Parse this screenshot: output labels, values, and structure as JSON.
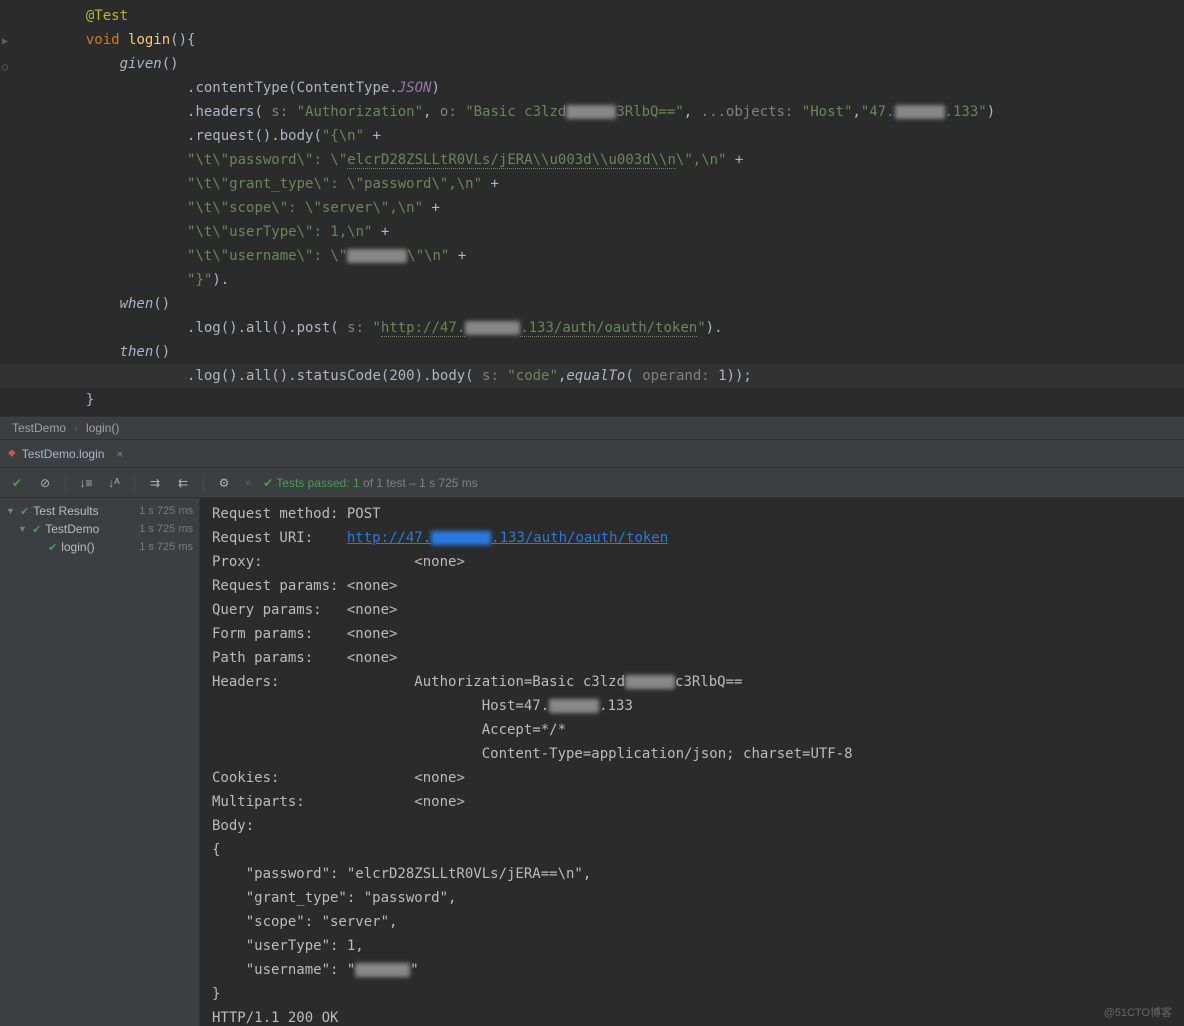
{
  "code": {
    "annotation": "@Test",
    "sig_void": "void",
    "sig_name": "login",
    "sig_paren": "(){",
    "given": "given",
    "contentType_method": ".contentType(ContentType.",
    "contentType_val": "JSON",
    "headers_method": ".headers(",
    "headers_hint1": " s: ",
    "headers_str1": "\"Authorization\"",
    "headers_hint2": " o: ",
    "headers_str2": "\"Basic c3lzd",
    "headers_str2b": "3RlbQ==\"",
    "headers_hint3": " ...objects: ",
    "headers_str3": "\"Host\"",
    "headers_str4": "\"47.",
    "headers_str4b": ".133\"",
    "request_body": ".request().body(",
    "rb_open": "\"{\\n\"",
    "rb_plus": " +",
    "rb_line1a": "\"\\t\\\"password\\\": \\\"",
    "rb_line1b": "elcrD28ZSLLtR0VLs/jERA\\\\u003d\\\\u003d\\\\n",
    "rb_line1c": "\\\",\\n\"",
    "rb_line2": "\"\\t\\\"grant_type\\\": \\\"password\\\",\\n\"",
    "rb_line3": "\"\\t\\\"scope\\\": \\\"server\\\",\\n\"",
    "rb_line4": "\"\\t\\\"userType\\\": 1,\\n\"",
    "rb_line5a": "\"\\t\\\"username\\\": \\\"",
    "rb_line5b": "\\\"\\n\"",
    "rb_close": "\"}\"",
    "rb_close_paren": ").",
    "when": "when",
    "log_post": ".log().all().post(",
    "log_post_hint": " s: ",
    "log_post_url_a": "\"",
    "log_post_url_b": "http://47.",
    "log_post_url_c": ".133/auth/oauth/token",
    "log_post_url_d": "\"",
    "log_post_close": ").",
    "then": "then",
    "then_line": ".log().all().statusCode(",
    "then_200": "200",
    "then_body": ").body(",
    "then_body_hint": " s: ",
    "then_body_str": "\"code\"",
    "then_equalTo": "equalTo",
    "then_operand_hint": " operand: ",
    "then_operand": "1",
    "then_close": "));",
    "brace_close": "}"
  },
  "breadcrumb": {
    "class": "TestDemo",
    "method": "login()"
  },
  "tab": {
    "label": "TestDemo.login"
  },
  "toolbar": {
    "summary_prefix": "Tests passed: ",
    "summary_count": "1",
    "summary_suffix": " of 1 test – 1 s 725 ms"
  },
  "tree": {
    "root": "Test Results",
    "root_time": "1 s 725 ms",
    "node1": "TestDemo",
    "node1_time": "1 s 725 ms",
    "node2": "login()",
    "node2_time": "1 s 725 ms"
  },
  "console": {
    "l1": "Request method:\tPOST",
    "l2a": "Request URI:\t",
    "l2b": "http://47.",
    "l2c": ".133/auth/oauth/token",
    "l3": "Proxy:\t\t\t<none>",
    "l4": "Request params:\t<none>",
    "l5": "Query params:\t<none>",
    "l6": "Form params:\t<none>",
    "l7": "Path params:\t<none>",
    "l8a": "Headers:\t\tAuthorization=Basic c3lzd",
    "l8b": "c3RlbQ==",
    "l9a": "\t\t\t\tHost=47.",
    "l9b": ".133",
    "l10": "\t\t\t\tAccept=*/*",
    "l11": "\t\t\t\tContent-Type=application/json; charset=UTF-8",
    "l12": "Cookies:\t\t<none>",
    "l13": "Multiparts:\t\t<none>",
    "l14": "Body:",
    "l15": "{",
    "l16": "    \"password\": \"elcrD28ZSLLtR0VLs/jERA==\\n\",",
    "l17": "    \"grant_type\": \"password\",",
    "l18": "    \"scope\": \"server\",",
    "l19": "    \"userType\": 1,",
    "l20a": "    \"username\": \"",
    "l20b": "\"",
    "l21": "}",
    "l22": "HTTP/1.1 200 OK"
  },
  "watermark": "@51CTO博客"
}
